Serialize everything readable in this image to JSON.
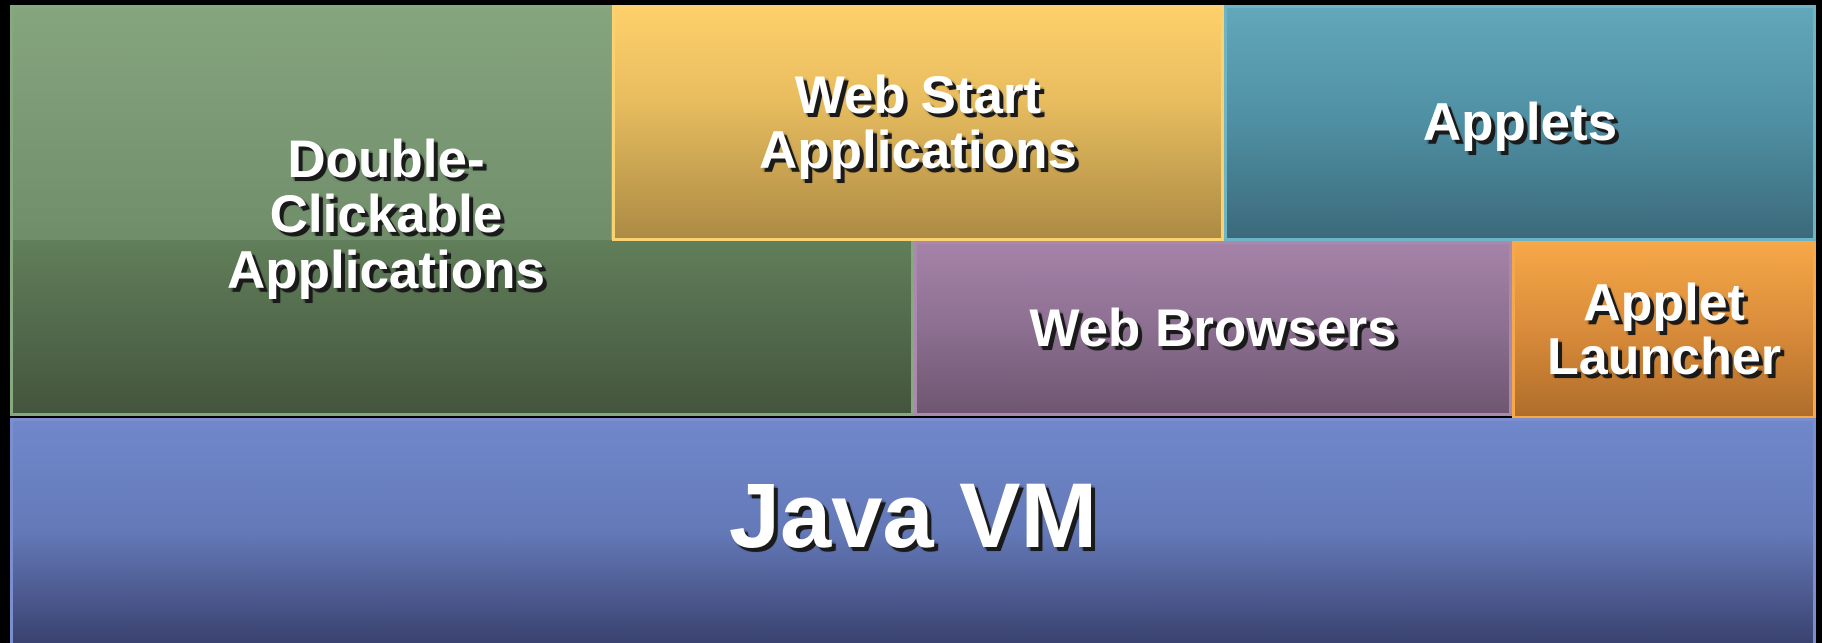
{
  "diagram": {
    "double_clickable": "Double-\nClickable\nApplications",
    "web_start": "Web Start\nApplications",
    "applets": "Applets",
    "web_browsers": "Web Browsers",
    "applet_launcher": "Applet\nLauncher",
    "java_vm": "Java VM"
  },
  "colors": {
    "double_clickable": "#6f8d69",
    "web_start": "#e8bd5f",
    "applets": "#4f8fa3",
    "web_browsers": "#8c6f91",
    "applet_launcher": "#d98c3a",
    "java_vm": "#6479b8",
    "background": "#000000"
  }
}
